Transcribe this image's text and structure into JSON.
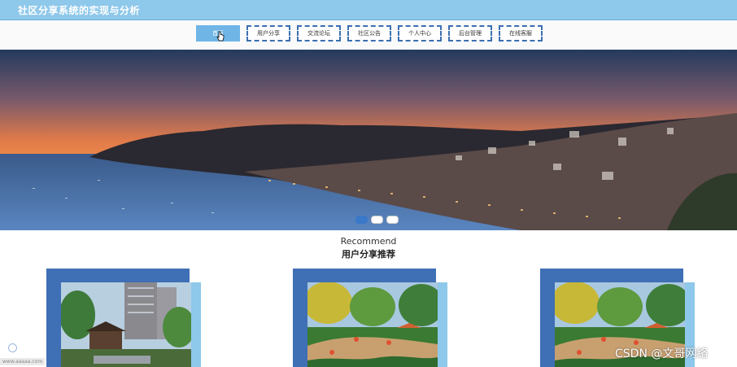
{
  "header": {
    "title": "社区分享系统的实现与分析"
  },
  "nav": {
    "items": [
      {
        "label": "首页",
        "active": true
      },
      {
        "label": "用户分享"
      },
      {
        "label": "交流论坛"
      },
      {
        "label": "社区公告"
      },
      {
        "label": "个人中心"
      },
      {
        "label": "后台管理"
      },
      {
        "label": "在线客服"
      }
    ]
  },
  "banner": {
    "dots": 3,
    "active_dot": 0
  },
  "section": {
    "en": "Recommend",
    "cn": "用户分享推荐"
  },
  "cards": [
    {
      "image": "residential-tower-garden"
    },
    {
      "image": "landscaped-park-garden"
    },
    {
      "image": "landscaped-park-garden"
    }
  ],
  "watermark": "CSDN @文哥网络",
  "footer_tiny": "www.aaaaa.com"
}
